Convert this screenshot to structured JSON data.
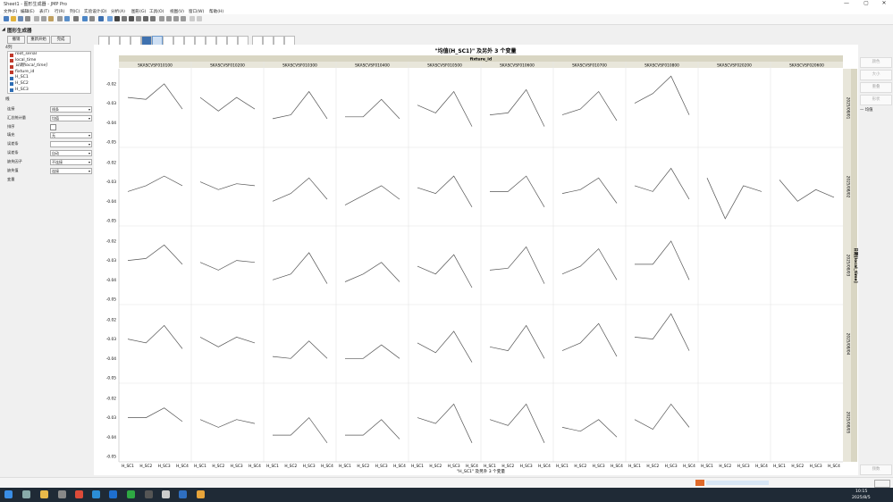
{
  "window": {
    "title": "Sheet1 - 图形生成器 - JMP Pro",
    "min": "—",
    "max": "▢",
    "close": "✕"
  },
  "menu": [
    "文件(F)",
    "编辑(E)",
    "表(T)",
    "行(R)",
    "列(C)",
    "实验设计(D)",
    "分析(A)",
    "图形(G)",
    "工具(O)",
    "视图(V)",
    "窗口(W)",
    "帮助(H)"
  ],
  "graph_builder": {
    "title": "图形生成器",
    "buttons": {
      "undo": "撤销",
      "restart": "重新开始",
      "done": "完成"
    }
  },
  "variables": {
    "header": "4列",
    "items": [
      "root_serial",
      "local_time",
      "日期[local_time]",
      "fixture_id",
      "H_SC1",
      "H_SC2",
      "H_SC3"
    ]
  },
  "properties": {
    "header": "线",
    "rows": [
      {
        "label": "连接",
        "value": "线条"
      },
      {
        "label": "汇总统计量",
        "value": "均值"
      },
      {
        "label": "排序",
        "value": ""
      },
      {
        "label": "填充",
        "value": "无"
      },
      {
        "label": "误差条",
        "value": ""
      },
      {
        "label": "误差条",
        "value": "自动"
      },
      {
        "label": "缺失因子",
        "value": "不连接"
      },
      {
        "label": "缺失值",
        "value": "连接"
      },
      {
        "label": "变量",
        "value": ""
      }
    ]
  },
  "right_panel": [
    "颜色",
    "大小",
    "重叠",
    "形状",
    "频数",
    "..."
  ],
  "right_legend": "— 均值",
  "chart_data": {
    "type": "line",
    "title": "\"均值(H_SC1)\" 及另外 3 个变量",
    "group_x_label": "fixture_id",
    "group_y_label": "日期[local_time]",
    "xlabel": "\"H_SC1\" 及另外 3 个变量",
    "x": [
      "H_SC1",
      "H_SC2",
      "H_SC3",
      "H_SC4"
    ],
    "ylim": [
      -0.05,
      -0.015
    ],
    "yticks": [
      "-0.02",
      "-0.03",
      "-0.04",
      "-0.05"
    ],
    "ytick_values": [
      -0.02,
      -0.03,
      -0.04,
      -0.05
    ],
    "columns": [
      "SKASCVSF010100",
      "SKASCVSF010200",
      "SKASCVSF010300",
      "SKASCVSF010400",
      "SKASCVSF010500",
      "SKASCVSF010600",
      "SKASCVSF010700",
      "SKASCVSF010800",
      "SKASCVSF020200",
      "SKASCVSF020600"
    ],
    "rows": [
      "2025/08/01",
      "2025/08/02",
      "2025/08/03",
      "2025/08/04",
      "2025/08/05"
    ],
    "panels": [
      [
        [
          -0.027,
          -0.028,
          -0.02,
          -0.033
        ],
        [
          -0.027,
          -0.034,
          -0.027,
          -0.033
        ],
        [
          -0.038,
          -0.036,
          -0.024,
          -0.038
        ],
        [
          -0.037,
          -0.037,
          -0.028,
          -0.038
        ],
        [
          -0.031,
          -0.035,
          -0.024,
          -0.042
        ],
        [
          -0.036,
          -0.035,
          -0.023,
          -0.042
        ],
        [
          -0.036,
          -0.033,
          -0.024,
          -0.039
        ],
        [
          -0.03,
          -0.025,
          -0.016,
          -0.036
        ],
        null,
        null
      ],
      [
        [
          -0.035,
          -0.032,
          -0.027,
          -0.032
        ],
        [
          -0.03,
          -0.034,
          -0.031,
          -0.032
        ],
        [
          -0.04,
          -0.036,
          -0.028,
          -0.039
        ],
        [
          -0.042,
          -0.037,
          -0.032,
          -0.039
        ],
        [
          -0.033,
          -0.036,
          -0.027,
          -0.043
        ],
        [
          -0.035,
          -0.035,
          -0.027,
          -0.043
        ],
        [
          -0.036,
          -0.034,
          -0.028,
          -0.041
        ],
        [
          -0.032,
          -0.035,
          -0.023,
          -0.039
        ],
        [
          -0.028,
          -0.049,
          -0.032,
          -0.035
        ],
        [
          -0.029,
          -0.04,
          -0.034,
          -0.038
        ]
      ],
      [
        [
          -0.03,
          -0.029,
          -0.022,
          -0.032
        ],
        [
          -0.031,
          -0.035,
          -0.03,
          -0.031
        ],
        [
          -0.04,
          -0.037,
          -0.026,
          -0.042
        ],
        [
          -0.041,
          -0.037,
          -0.031,
          -0.041
        ],
        [
          -0.033,
          -0.037,
          -0.027,
          -0.044
        ],
        [
          -0.035,
          -0.034,
          -0.023,
          -0.042
        ],
        [
          -0.037,
          -0.033,
          -0.024,
          -0.04
        ],
        [
          -0.032,
          -0.032,
          -0.02,
          -0.04
        ],
        null,
        null
      ],
      [
        [
          -0.03,
          -0.032,
          -0.023,
          -0.035
        ],
        [
          -0.029,
          -0.034,
          -0.029,
          -0.032
        ],
        [
          -0.039,
          -0.04,
          -0.031,
          -0.04
        ],
        [
          -0.04,
          -0.04,
          -0.033,
          -0.04
        ],
        [
          -0.032,
          -0.037,
          -0.026,
          -0.042
        ],
        [
          -0.034,
          -0.036,
          -0.023,
          -0.04
        ],
        [
          -0.036,
          -0.032,
          -0.022,
          -0.039
        ],
        [
          -0.029,
          -0.03,
          -0.017,
          -0.036
        ],
        null,
        null
      ],
      [
        [
          -0.03,
          -0.03,
          -0.025,
          -0.032
        ],
        [
          -0.031,
          -0.035,
          -0.031,
          -0.033
        ],
        [
          -0.039,
          -0.039,
          -0.03,
          -0.043
        ],
        [
          -0.039,
          -0.039,
          -0.031,
          -0.041
        ],
        [
          -0.03,
          -0.033,
          -0.023,
          -0.043
        ],
        [
          -0.031,
          -0.034,
          -0.023,
          -0.043
        ],
        [
          -0.035,
          -0.037,
          -0.031,
          -0.04
        ],
        [
          -0.031,
          -0.036,
          -0.023,
          -0.035
        ],
        null,
        null
      ]
    ]
  },
  "taskbar": {
    "time": "10:15",
    "date": "2025/8/5"
  }
}
